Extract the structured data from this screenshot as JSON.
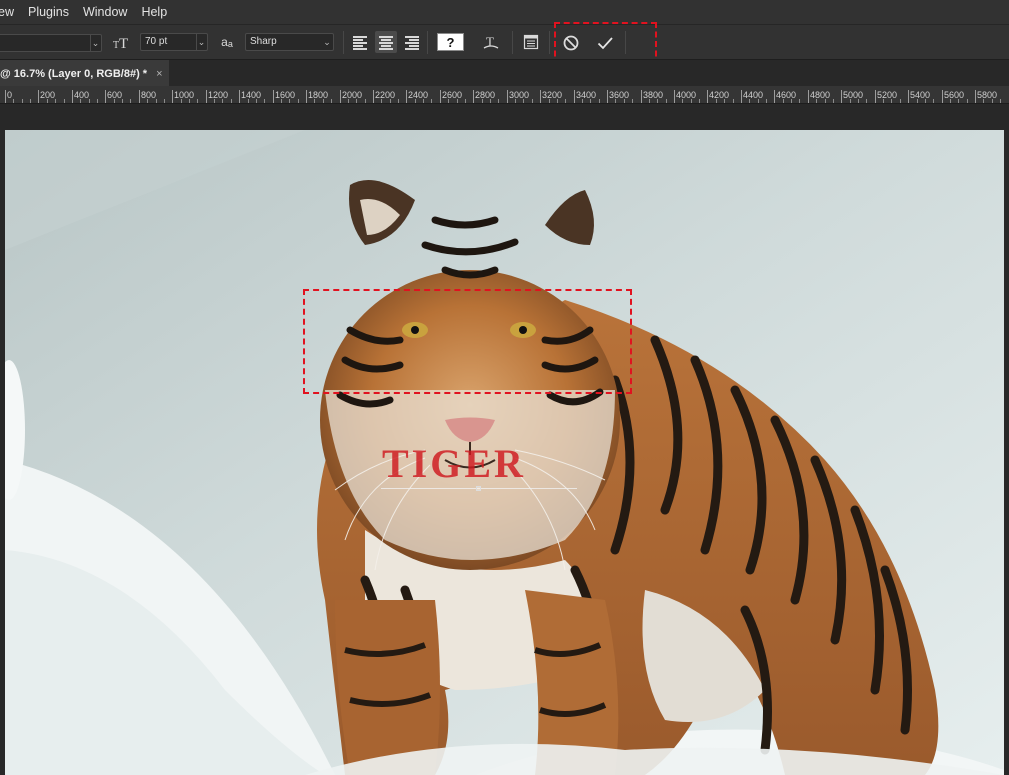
{
  "menu": {
    "items": [
      "ew",
      "Plugins",
      "Window",
      "Help"
    ]
  },
  "options_bar": {
    "font_size": "70 pt",
    "antialias": "Sharp",
    "antialias_prefix": "a",
    "antialias_small": "a",
    "color_swatch_glyph": "?",
    "accent_highlight": "#e1121f",
    "icons": [
      "dropdown-arrow-icon",
      "text-size-icon",
      "antialias-icon",
      "align-left-icon",
      "align-center-icon",
      "align-right-icon",
      "text-color-swatch",
      "warp-text-icon",
      "character-paragraph-panel-icon",
      "cancel-icon",
      "commit-check-icon"
    ]
  },
  "document_tab": {
    "title": "@ 16.7% (Layer 0, RGB/8#) *",
    "close": "×"
  },
  "ruler": {
    "labels": [
      "0",
      "200",
      "400",
      "600",
      "800",
      "1000",
      "1200",
      "1400",
      "1600",
      "1800",
      "2000",
      "2200",
      "2400",
      "2600",
      "2800",
      "3000",
      "3200",
      "3400",
      "3600",
      "3800",
      "4000",
      "4200",
      "4400",
      "4600",
      "4800",
      "5000",
      "5200",
      "5400",
      "5600",
      "5800"
    ]
  },
  "canvas": {
    "text_layer": "TIGER",
    "text_color": "#ce191f"
  }
}
